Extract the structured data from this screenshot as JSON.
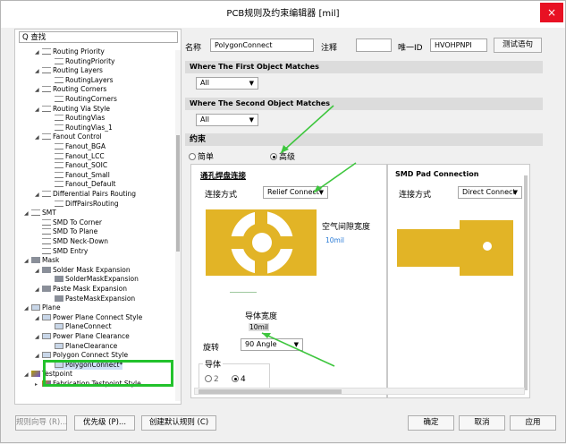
{
  "window": {
    "title": "PCB规则及约束编辑器 [mil]",
    "close_glyph": "×"
  },
  "search": {
    "value": "Q 查找"
  },
  "tree": [
    {
      "label": "Routing Priority",
      "depth": 2,
      "icon": "rule-icon",
      "expand": "◢"
    },
    {
      "label": "RoutingPriority",
      "depth": 3,
      "icon": "rule-icon",
      "expand": ""
    },
    {
      "label": "Routing Layers",
      "depth": 2,
      "icon": "rule-icon",
      "expand": "◢"
    },
    {
      "label": "RoutingLayers",
      "depth": 3,
      "icon": "rule-icon",
      "expand": ""
    },
    {
      "label": "Routing Corners",
      "depth": 2,
      "icon": "rule-icon",
      "expand": "◢"
    },
    {
      "label": "RoutingCorners",
      "depth": 3,
      "icon": "rule-icon",
      "expand": ""
    },
    {
      "label": "Routing Via Style",
      "depth": 2,
      "icon": "rule-icon",
      "expand": "◢"
    },
    {
      "label": "RoutingVias",
      "depth": 3,
      "icon": "rule-icon",
      "expand": ""
    },
    {
      "label": "RoutingVias_1",
      "depth": 3,
      "icon": "rule-icon",
      "expand": ""
    },
    {
      "label": "Fanout Control",
      "depth": 2,
      "icon": "rule-icon",
      "expand": "◢"
    },
    {
      "label": "Fanout_BGA",
      "depth": 3,
      "icon": "rule-icon",
      "expand": ""
    },
    {
      "label": "Fanout_LCC",
      "depth": 3,
      "icon": "rule-icon",
      "expand": ""
    },
    {
      "label": "Fanout_SOIC",
      "depth": 3,
      "icon": "rule-icon",
      "expand": ""
    },
    {
      "label": "Fanout_Small",
      "depth": 3,
      "icon": "rule-icon",
      "expand": ""
    },
    {
      "label": "Fanout_Default",
      "depth": 3,
      "icon": "rule-icon",
      "expand": ""
    },
    {
      "label": "Differential Pairs Routing",
      "depth": 2,
      "icon": "rule-icon",
      "expand": "◢"
    },
    {
      "label": "DiffPairsRouting",
      "depth": 3,
      "icon": "rule-icon",
      "expand": ""
    },
    {
      "label": "SMT",
      "depth": 1,
      "icon": "smt-icon",
      "expand": "◢"
    },
    {
      "label": "SMD To Corner",
      "depth": 2,
      "icon": "smt-icon",
      "expand": ""
    },
    {
      "label": "SMD To Plane",
      "depth": 2,
      "icon": "smt-icon",
      "expand": ""
    },
    {
      "label": "SMD Neck-Down",
      "depth": 2,
      "icon": "smt-icon",
      "expand": ""
    },
    {
      "label": "SMD Entry",
      "depth": 2,
      "icon": "smt-icon",
      "expand": ""
    },
    {
      "label": "Mask",
      "depth": 1,
      "icon": "mask-icon",
      "expand": "◢"
    },
    {
      "label": "Solder Mask Expansion",
      "depth": 2,
      "icon": "mask-icon",
      "expand": "◢"
    },
    {
      "label": "SolderMaskExpansion",
      "depth": 3,
      "icon": "mask-icon",
      "expand": ""
    },
    {
      "label": "Paste Mask Expansion",
      "depth": 2,
      "icon": "mask-icon",
      "expand": "◢"
    },
    {
      "label": "PasteMaskExpansion",
      "depth": 3,
      "icon": "mask-icon",
      "expand": ""
    },
    {
      "label": "Plane",
      "depth": 1,
      "icon": "plane-icon",
      "expand": "◢"
    },
    {
      "label": "Power Plane Connect Style",
      "depth": 2,
      "icon": "plane-icon",
      "expand": "◢"
    },
    {
      "label": "PlaneConnect",
      "depth": 3,
      "icon": "plane-icon",
      "expand": ""
    },
    {
      "label": "Power Plane Clearance",
      "depth": 2,
      "icon": "plane-icon",
      "expand": "◢"
    },
    {
      "label": "PlaneClearance",
      "depth": 3,
      "icon": "plane-icon",
      "expand": ""
    },
    {
      "label": "Polygon Connect Style",
      "depth": 2,
      "icon": "plane-icon",
      "expand": "◢"
    },
    {
      "label": "PolygonConnect*",
      "depth": 3,
      "icon": "plane-icon",
      "expand": "",
      "selected": true
    },
    {
      "label": "Testpoint",
      "depth": 1,
      "icon": "testpoint-icon",
      "expand": "◢"
    },
    {
      "label": "Fabrication Testpoint Style",
      "depth": 2,
      "icon": "testpoint-icon",
      "expand": "▸"
    }
  ],
  "rule": {
    "name_label": "名称",
    "name_value": "PolygonConnect",
    "comment_label": "注释",
    "comment_value": "",
    "id_label": "唯一ID",
    "id_value": "HVOHPNPI",
    "test_button": "测试语句"
  },
  "first_match": {
    "header": "Where The First Object Matches",
    "value": "All"
  },
  "second_match": {
    "header": "Where The Second Object Matches",
    "value": "All"
  },
  "constraints": {
    "header": "约束",
    "simple_label": "简单",
    "advanced_label": "高级",
    "mode": "advanced"
  },
  "via_pad": {
    "title": "通孔焊盘连接",
    "connect_label": "连接方式",
    "connect_value": "Relief Connect",
    "air_gap_label": "空气间隙宽度",
    "air_gap_value": "10mil",
    "conductor_width_label": "导体宽度",
    "conductor_width_value": "10mil",
    "rotation_label": "旋转",
    "rotation_value": "90 Angle",
    "conductors_label": "导体",
    "conductor_options": [
      "2",
      "4"
    ],
    "conductor_selected": "4"
  },
  "smd_pad": {
    "title": "SMD Pad Connection",
    "connect_label": "连接方式",
    "connect_value": "Direct Connect"
  },
  "footer": {
    "wizard": "规则向导 (R)...",
    "priority": "优先级 (P)...",
    "create_default": "创建默认规则 (C)",
    "ok": "确定",
    "cancel": "取消",
    "apply": "应用"
  },
  "colors": {
    "copper": "#e2b426",
    "annotation_arrow": "#3ec63e",
    "highlight_box": "#22c22c"
  }
}
